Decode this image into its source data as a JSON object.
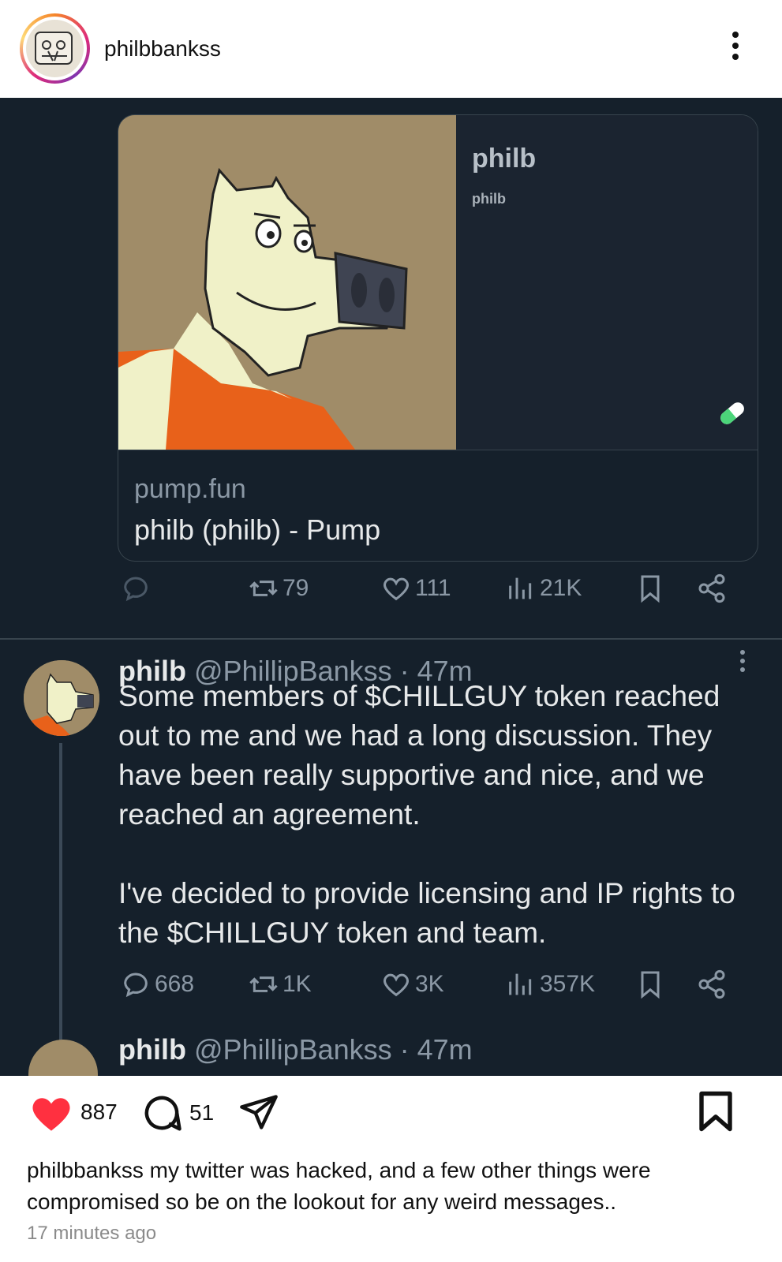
{
  "instagram": {
    "username": "philbbankss",
    "likes": "887",
    "comments": "51",
    "caption_user": "philbbankss",
    "caption_text": "my twitter was hacked, and a few other things were compromised so be on the lookout for any weird messages..",
    "time_ago": "17 minutes ago"
  },
  "tweet1": {
    "card": {
      "side_title": "philb",
      "side_subtitle": "philb",
      "domain": "pump.fun",
      "title": "philb (philb) - Pump"
    },
    "stats": {
      "replies": "",
      "retweets": "79",
      "likes": "111",
      "views": "21K"
    }
  },
  "tweet2": {
    "name": "philb",
    "handle": "@PhillipBankss · 47m",
    "text": "Some members of $CHILLGUY token reached out to me and we had a long discussion. They have been really supportive and nice, and we reached an agreement.\n\nI've decided to provide licensing and IP rights to the $CHILLGUY token and team.",
    "stats": {
      "replies": "668",
      "retweets": "1K",
      "likes": "3K",
      "views": "357K"
    }
  },
  "tweet3_partial": {
    "name": "philb",
    "handle": "@PhillipBankss · 47m"
  },
  "colors": {
    "twitter_bg": "#15202b",
    "ig_heart": "#ff3040"
  }
}
